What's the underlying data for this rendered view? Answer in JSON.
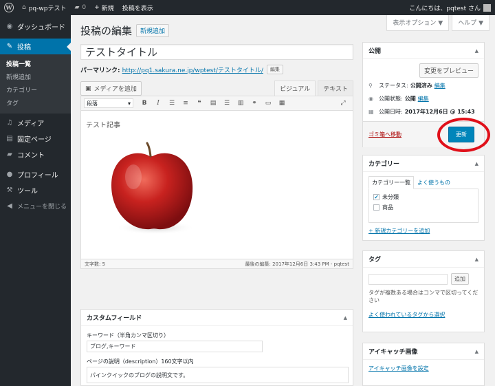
{
  "adminbar": {
    "site_name": "pq-wpテスト",
    "comments_count": "0",
    "new_label": "新規",
    "view_post": "投稿を表示",
    "greeting": "こんにちは、pqtest さん"
  },
  "sidebar": {
    "dashboard": "ダッシュボード",
    "posts": "投稿",
    "sub": [
      "投稿一覧",
      "新規追加",
      "カテゴリー",
      "タグ"
    ],
    "media": "メディア",
    "pages": "固定ページ",
    "comments": "コメント",
    "profile": "プロフィール",
    "tools": "ツール",
    "collapse": "メニューを閉じる"
  },
  "screen_meta": {
    "options": "表示オプション ▼",
    "help": "ヘルプ ▼"
  },
  "main": {
    "page_title": "投稿の編集",
    "add_new": "新規追加",
    "post_title": "テストタイトル",
    "permalink_label": "パーマリンク:",
    "permalink_url": "http://pq1.sakura.ne.jp/wptest/テストタイトル/",
    "edit_label": "編集",
    "add_media": "メディアを追加",
    "tab_visual": "ビジュアル",
    "tab_text": "テキスト",
    "format_select": "段落",
    "content_text": "テスト記事",
    "word_count": "文字数: 5",
    "last_edited": "最後の編集: 2017年12月6日 3:43 PM - pqtest"
  },
  "custom_fields": {
    "heading": "カスタムフィールド",
    "keyword_label": "キーワード（半角カンマ区切り）",
    "keyword_value": "ブログ,キーワード",
    "desc_label": "ページの説明（description）160文字以内",
    "desc_value": "パインクイックのブログの説明文です。"
  },
  "publish": {
    "heading": "公開",
    "preview": "変更をプレビュー",
    "status_label": "ステータス:",
    "status_value": "公開済み",
    "visibility_label": "公開状態:",
    "visibility_value": "公開",
    "date_label": "公開日時:",
    "date_value": "2017年12月6日 @ 15:43",
    "edit": "編集",
    "trash": "ゴミ箱へ移動",
    "update": "更新"
  },
  "categories": {
    "heading": "カテゴリー",
    "tab_all": "カテゴリー一覧",
    "tab_popular": "よく使うもの",
    "items": [
      "未分類",
      "商品"
    ],
    "add_new": "+ 新規カテゴリーを追加"
  },
  "tags": {
    "heading": "タグ",
    "add": "追加",
    "hint": "タグが複数ある場合はコンマで区切ってください",
    "popular_link": "よく使われているタグから選択"
  },
  "featured": {
    "heading": "アイキャッチ画像",
    "set_link": "アイキャッチ画像を設定"
  },
  "colors": {
    "admin_dark": "#23282d",
    "accent": "#0073aa",
    "primary_button": "#0085ba",
    "highlight_ring": "#e0101a"
  }
}
